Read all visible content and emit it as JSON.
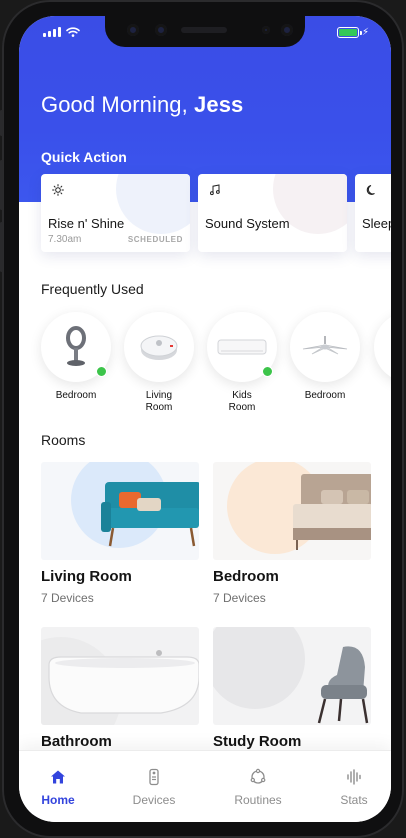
{
  "status_bar": {
    "signal": "signal-icon",
    "wifi": "wifi-icon",
    "battery": "battery-charging-icon"
  },
  "header": {
    "greeting_prefix": "Good Morning,",
    "user_name": "Jess",
    "quick_action_title": "Quick Action"
  },
  "quick_actions": [
    {
      "icon": "sun-icon",
      "title": "Rise n' Shine",
      "time": "7.30am",
      "tag": "SCHEDULED"
    },
    {
      "icon": "music-note-icon",
      "title": "Sound System"
    },
    {
      "icon": "moon-icon",
      "title": "Sleep"
    }
  ],
  "frequently_used": {
    "title": "Frequently Used",
    "items": [
      {
        "device": "fan-icon",
        "label": "Bedroom",
        "online": true
      },
      {
        "device": "robot-vacuum-icon",
        "label": "Living\nRoom",
        "online": false
      },
      {
        "device": "air-conditioner-icon",
        "label": "Kids\nRoom",
        "online": true
      },
      {
        "device": "ceiling-fan-icon",
        "label": "Bedroom",
        "online": false
      }
    ]
  },
  "rooms": {
    "title": "Rooms",
    "items": [
      {
        "name": "Living Room",
        "devices": "7 Devices"
      },
      {
        "name": "Bedroom",
        "devices": "7 Devices"
      },
      {
        "name": "Bathroom",
        "devices": ""
      },
      {
        "name": "Study Room",
        "devices": ""
      }
    ]
  },
  "nav": {
    "items": [
      {
        "icon": "home-icon",
        "label": "Home",
        "active": true
      },
      {
        "icon": "remote-icon",
        "label": "Devices",
        "active": false
      },
      {
        "icon": "routines-icon",
        "label": "Routines",
        "active": false
      },
      {
        "icon": "stats-icon",
        "label": "Stats",
        "active": false
      }
    ]
  },
  "colors": {
    "accent": "#3344dd",
    "hero": "#3a4de6",
    "online": "#3cc44a"
  }
}
